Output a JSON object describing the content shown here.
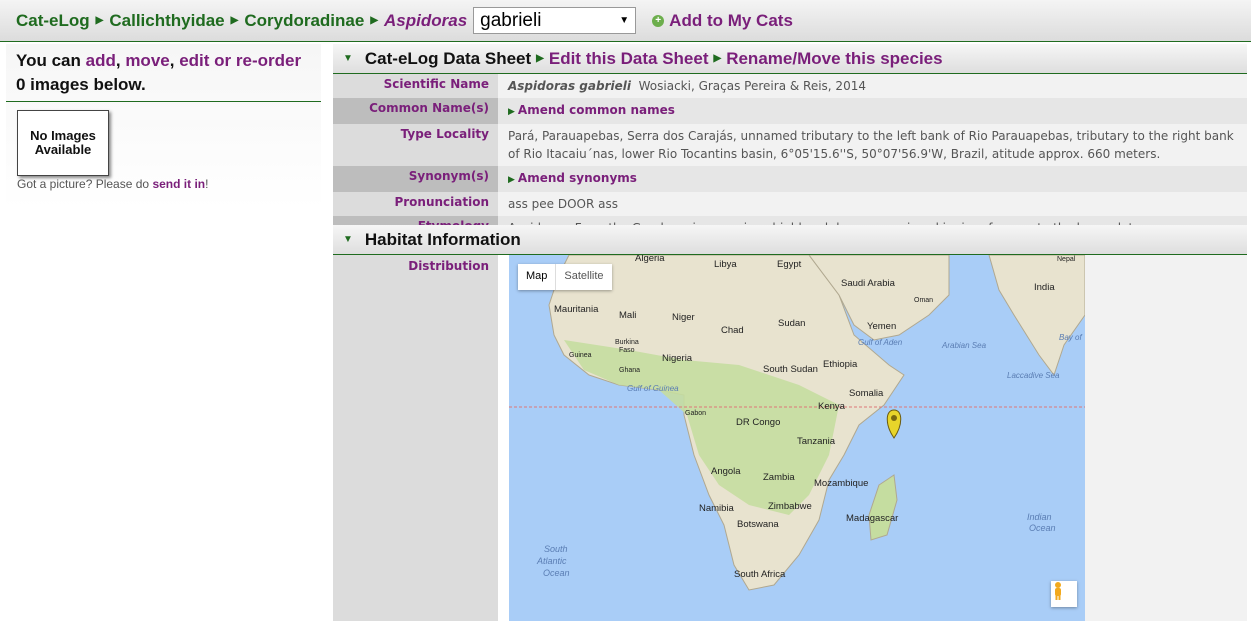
{
  "breadcrumb": {
    "items": [
      "Cat-eLog",
      "Callichthyidae",
      "Corydoradinae"
    ],
    "genus": "Aspidoras",
    "species_selected": "gabrieli",
    "add_to_cats": "Add to My Cats"
  },
  "left_panel": {
    "prefix": "You can",
    "add": "add",
    "comma1": ",",
    "move": "move",
    "comma2": ",",
    "edit_or": "edit or re-order",
    "count_line": "0 images below.",
    "no_image": "No Images Available",
    "got_picture": "Got a picture? Please do",
    "send_link": "send it in",
    "exclaim": "!"
  },
  "datasheet_header": {
    "title": "Cat-eLog Data Sheet",
    "edit": "Edit this Data Sheet",
    "rename": "Rename/Move this species"
  },
  "rows": {
    "scientific_name_label": "Scientific Name",
    "scientific_name": "Aspidoras gabrieli",
    "authority": "Wosiacki, Graças Pereira & Reis, 2014",
    "common_names_label": "Common Name(s)",
    "amend_common": "Amend common names",
    "type_locality_label": "Type Locality",
    "type_locality": "Pará, Parauapebas, Serra dos Carajás, unnamed tributary to the left bank of Rio Parauapebas, tributary to the right bank of Rio Itacaiu´nas, lower Rio Tocantins basin, 6°05'15.6''S, 50°07'56.9'W, Brazil, atitude approx. 660 meters.",
    "synonyms_label": "Synonym(s)",
    "amend_synonyms": "Amend synonyms",
    "pronunciation_label": "Pronunciation",
    "pronunciation": "ass pee DOOR ass",
    "etymology_label": "Etymology",
    "etymology": "Aspidoras: From the Greek aspis, meaning shield and doras, meaning skin; in reference to the bony plates."
  },
  "habitat_header": {
    "title": "Habitat Information"
  },
  "distribution": {
    "label": "Distribution",
    "map_tab": "Map",
    "satellite_tab": "Satellite",
    "labels": {
      "algeria": "Algeria",
      "libya": "Libya",
      "egypt": "Egypt",
      "saudi": "Saudi Arabia",
      "oman": "Oman",
      "india": "India",
      "nepal": "Nepal",
      "mauritania": "Mauritania",
      "mali": "Mali",
      "niger": "Niger",
      "chad": "Chad",
      "sudan": "Sudan",
      "yemen": "Yemen",
      "burkina": "Burkina",
      "faso": "Faso",
      "guinea": "Guinea",
      "nigeria": "Nigeria",
      "ghana": "Ghana",
      "ethiopia": "Ethiopia",
      "south_sudan": "South Sudan",
      "somalia": "Somalia",
      "kenya": "Kenya",
      "gabon": "Gabon",
      "dr_congo": "DR Congo",
      "tanzania": "Tanzania",
      "angola": "Angola",
      "zambia": "Zambia",
      "mozambique": "Mozambique",
      "namibia": "Namibia",
      "zimbabwe": "Zimbabwe",
      "botswana": "Botswana",
      "madagascar": "Madagascar",
      "south_africa": "South Africa"
    },
    "oceans": {
      "gulf_aden": "Gulf of Aden",
      "arabian_sea": "Arabian Sea",
      "bay": "Bay of",
      "laccadive": "Laccadive Sea",
      "gulf_guinea": "Gulf of Guinea",
      "indian1": "Indian",
      "indian2": "Ocean",
      "south_atl1": "South",
      "south_atl2": "Atlantic",
      "south_atl3": "Ocean"
    },
    "colors": {
      "water": "#a9cdf7",
      "land": "#e8e3cf",
      "green": "#c5dda0"
    }
  }
}
